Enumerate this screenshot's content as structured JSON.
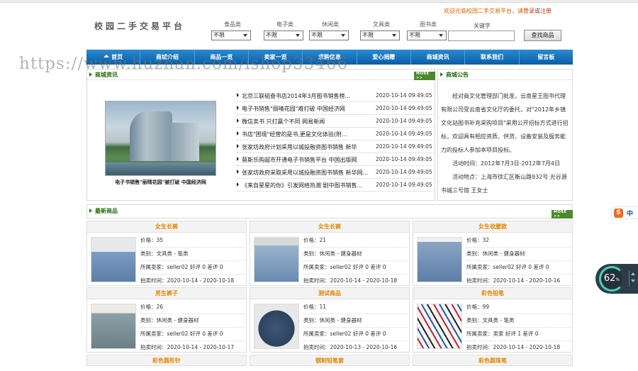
{
  "header": {
    "logo": "校园二手交易平台",
    "welcome": {
      "prefix": "欢迎光临校园二手交易平台，请",
      "login": "登录",
      "or": "或",
      "register": "注册"
    },
    "filters": [
      {
        "label": "食品类",
        "value": "不限"
      },
      {
        "label": "电子类",
        "value": "不限"
      },
      {
        "label": "休闲类",
        "value": "不限"
      },
      {
        "label": "文具类",
        "value": "不限"
      },
      {
        "label": "图书类",
        "value": "不限"
      }
    ],
    "keyword_label": "关键字",
    "keyword_value": "",
    "search_button": "查找商品"
  },
  "nav": [
    "首页",
    "商城介绍",
    "商品一览",
    "卖家一览",
    "求购信息",
    "爱心捐赠",
    "商城资讯",
    "联系我们",
    "留言板"
  ],
  "watermark": "https://www.huzhan.com/ishop33466",
  "news": {
    "title": "商城资讯",
    "more": "MORE >>",
    "photo_caption": "电子书销售\"丽晴花园\"被打破 中国经济网",
    "items": [
      {
        "title": "北京三联韬奋书店2014年3月图书销售榜...",
        "date": "2020-10-14 09:49:05"
      },
      {
        "title": "电子书销售\"丽晴花园\"难打破 中国经济网",
        "date": "2020-10-14 09:49:05"
      },
      {
        "title": "微信卖书 只打赢个不同 网易新闻",
        "date": "2020-10-14 09:49:05"
      },
      {
        "title": "书店\"困境\"经营的是书,更是文化体验(附...",
        "date": "2020-10-14 09:49:05"
      },
      {
        "title": "张家坊政府计划采用以城投融资图书销售 新华",
        "date": "2020-10-14 09:49:05"
      },
      {
        "title": "莫斯乐购超市开通电子书销售平台 中国出版网",
        "date": "2020-10-14 09:49:05"
      },
      {
        "title": "张家坊政府采取采用以城投融资图书销售 新华网重庆",
        "date": "2020-10-14 09:49:05"
      },
      {
        "title": "《来自星星的你》引发网络热潮 剧中图书销售...",
        "date": "2020-10-14 09:49:05"
      }
    ]
  },
  "notice": {
    "title": "商城公告",
    "body": "经对商文化管理部门批准，云南星王图书代理有限公司受云南省文化厅的委托，对\"2012年乡镇文化站图书补充采购项目\"采用公开招标方式进行招标，欢迎具有相应资质、供货、设备安装及服务能力的投标人参加本项目投标。",
    "time_line": "活动时间：2012年7月3日-2012年7月4日",
    "place_line": "活动地点：上海市徐汇区衡山路932号 光谷源书城三号馆 王女士"
  },
  "products": {
    "title": "最新商品",
    "more": "MORE >>",
    "items": [
      {
        "name": "女生长裤",
        "price": "价格：35",
        "category": "类别：文具类 - 笔类",
        "seller": "所属卖家：seller02 好评 0 差评 0",
        "time": "拍卖时间：2020-10-14 - 2020-10-18"
      },
      {
        "name": "女生长裤",
        "price": "价格：21",
        "category": "类别：休闲类 - 健身器材",
        "seller": "所属卖家：seller02 好评 0 差评 0",
        "time": "拍卖时间：2020-10-14 - 2020-10-18"
      },
      {
        "name": "女生收腰款",
        "price": "价格：32",
        "category": "类别：休闲类 - 健身器材",
        "seller": "所属卖家：seller02 好评 0 差评 0",
        "time": "拍卖时间：2020-10-14 - 2020-10-16"
      },
      {
        "name": "男生裤子",
        "price": "价格：26",
        "category": "类别：休闲类 - 健身器材",
        "seller": "所属卖家：seller02 好评 0 差评 0",
        "time": "拍卖时间：2020-10-14 - 2020-10-17"
      },
      {
        "name": "测试商品",
        "price": "价格：11",
        "category": "类别：休闲类 - 健身器材",
        "seller": "所属卖家：seller02 好评 0 差评 0",
        "time": "拍卖时间：2020-10-13 - 2020-10-16"
      },
      {
        "name": "彩色铅笔",
        "price": "价格：99",
        "category": "类别：文具类 - 笔类",
        "seller": "所属卖家：卖家 好评 1 差评 0",
        "time": "拍卖时间：2020-10-14 - 2020-10-18"
      }
    ],
    "bottom_titles": [
      "彩色圆形针",
      "钢制铅笔套",
      "彩色圆珠笔"
    ]
  },
  "widgets": {
    "sogou_letter": "S",
    "sogou_lang": "中",
    "speed_value": "62",
    "speed_unit": "%"
  }
}
